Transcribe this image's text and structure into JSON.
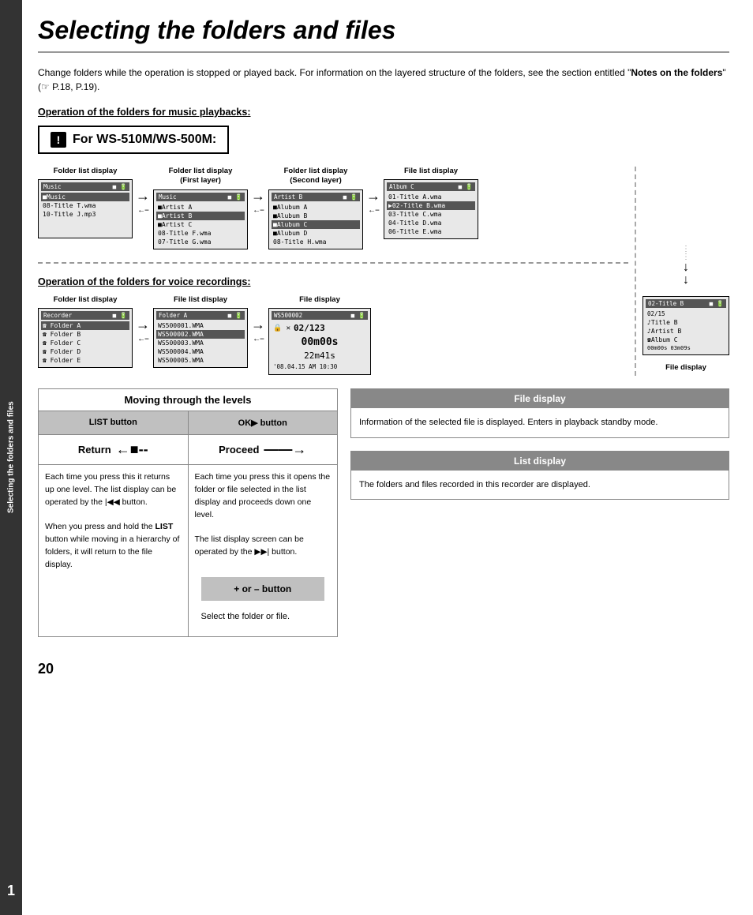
{
  "page": {
    "title": "Selecting the folders and files",
    "number": "20"
  },
  "side_tab": {
    "number": "1",
    "text": "Selecting the folders and files"
  },
  "intro": {
    "text": "Change folders while the operation is stopped or played back. For information on the layered structure of the folders, see the section entitled \"",
    "bold_text": "Notes on the folders",
    "text2": "\" (",
    "ref": "☞ P.18, P.19",
    "text3": ")."
  },
  "music_section": {
    "header": "Operation of the folders for music playbacks:",
    "model_box": {
      "icon": "!",
      "label": "For WS-510M/WS-500M:"
    },
    "screens": [
      {
        "label": "Folder list display",
        "title": "Music",
        "rows": [
          "■Music",
          "08-Title T.wma",
          "10-Title J.mp3"
        ],
        "highlight": 1
      },
      {
        "label": "Folder list display\n(First layer)",
        "title": "Music",
        "rows": [
          "■Artist A",
          "■Artist B",
          "■Artist C",
          "08-Title F.wma",
          "07-Title G.wma"
        ],
        "highlight": 2
      },
      {
        "label": "Folder list display\n(Second layer)",
        "title": "Artist B",
        "rows": [
          "■Alubum A",
          "■Alubum B",
          "■Alubum C",
          "■Alubum D",
          "08-Title H.wma"
        ],
        "highlight": 3
      },
      {
        "label": "File list display",
        "title": "Album C",
        "rows": [
          "01-Title A.wma",
          "02-Title B.wma",
          "03-Title C.wma",
          "04-Title D.wma",
          "06-Title E.wma"
        ],
        "highlight": 2
      }
    ]
  },
  "voice_section": {
    "header": "Operation of the folders for voice recordings:",
    "screens": [
      {
        "label": "Folder list display",
        "title": "Recorder",
        "rows": [
          "☎Folder A",
          "☎Folder B",
          "☎Folder C",
          "☎Folder D",
          "☎Folder E"
        ],
        "highlight": 1
      },
      {
        "label": "File list display",
        "title": "Folder A",
        "rows": [
          "WS500001.WMA",
          "WS500002.WMA",
          "WS500003.WMA",
          "WS500004.WMA",
          "WS500005.WMA"
        ],
        "highlight": 2
      },
      {
        "label": "File display",
        "title": "WS500002",
        "rows": [
          "02/123",
          "00m00s",
          "22m41s",
          "'08.04.15 AM 10:30"
        ],
        "highlight": 0
      }
    ],
    "file_display": {
      "label": "File display",
      "title": "02-Title B",
      "rows": [
        "02/15",
        "♪Title B",
        "☎Artist B",
        "☎Album C",
        "00m00s    03m09s"
      ]
    }
  },
  "levels": {
    "title": "Moving through the levels",
    "list_button": "LIST button",
    "ok_button": "OK▶ button",
    "return_label": "Return",
    "proceed_label": "Proceed",
    "list_desc": "Each time you press this it returns up one level. The list display can be operated by the |◀◀ button.\nWhen you press and hold the LIST button while moving in a hierarchy of folders, it will return to the file display.",
    "ok_desc": "Each time you press this it opens the folder or file selected in the list display and proceeds down one level.\nThe list display screen can be operated by the ▶▶| button.",
    "plus_or_btn": "+ or – button",
    "select_text": "Select the folder or file."
  },
  "file_display_box": {
    "title": "File display",
    "content": "Information of the selected file is displayed. Enters in playback standby mode."
  },
  "list_display_box": {
    "title": "List display",
    "content": "The folders and files recorded in this recorder are displayed."
  }
}
